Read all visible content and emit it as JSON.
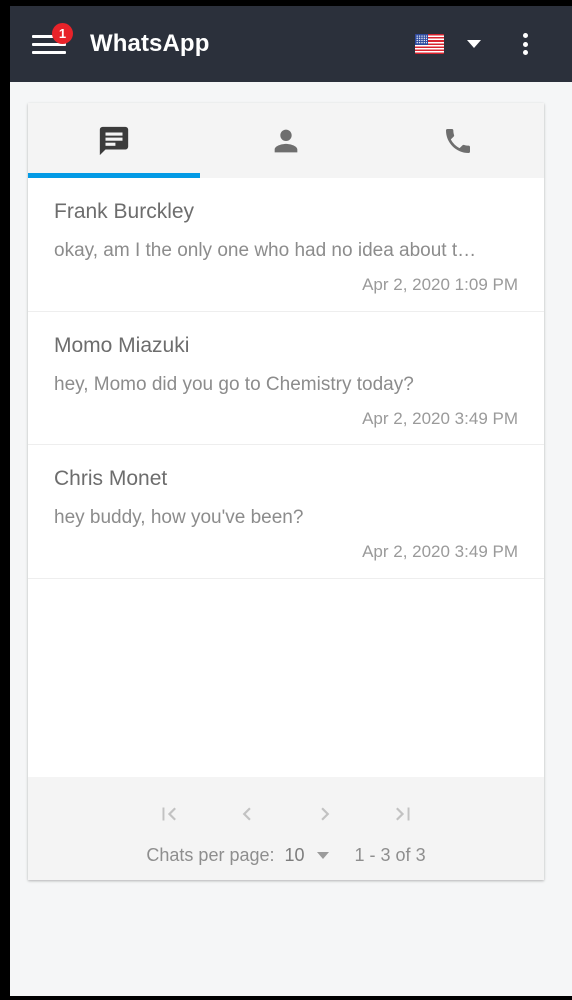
{
  "appbar": {
    "menu_icon": "hamburger-menu-icon",
    "badge_count": "1",
    "title": "WhatsApp",
    "language_flag": "us-flag-icon",
    "language_caret": "chevron-down-icon",
    "overflow_icon": "more-vertical-icon",
    "background_color": "#2b303b",
    "badge_color": "#e8232a"
  },
  "tabs": {
    "active_index": 0,
    "indicator_color": "#039ae5",
    "items": [
      {
        "name": "chats",
        "icon": "chat-bubble-icon",
        "active": true
      },
      {
        "name": "contacts",
        "icon": "person-icon",
        "active": false
      },
      {
        "name": "calls",
        "icon": "phone-icon",
        "active": false
      }
    ]
  },
  "chats": [
    {
      "name": "Frank Burckley",
      "message": "okay, am I the only one who had no idea about t…",
      "timestamp": "Apr 2, 2020 1:09 PM"
    },
    {
      "name": "Momo Miazuki",
      "message": "hey, Momo did you go to Chemistry today?",
      "timestamp": "Apr 2, 2020 3:49 PM"
    },
    {
      "name": "Chris Monet",
      "message": "hey buddy, how you've been?",
      "timestamp": "Apr 2, 2020 3:49 PM"
    }
  ],
  "paginator": {
    "first_page_icon": "first-page-icon",
    "previous_page_icon": "chevron-left-icon",
    "next_page_icon": "chevron-right-icon",
    "last_page_icon": "last-page-icon",
    "items_per_page_label": "Chats per page:",
    "items_per_page_value": "10",
    "items_per_page_caret": "chevron-down-icon",
    "range_label": "1 - 3 of 3"
  }
}
